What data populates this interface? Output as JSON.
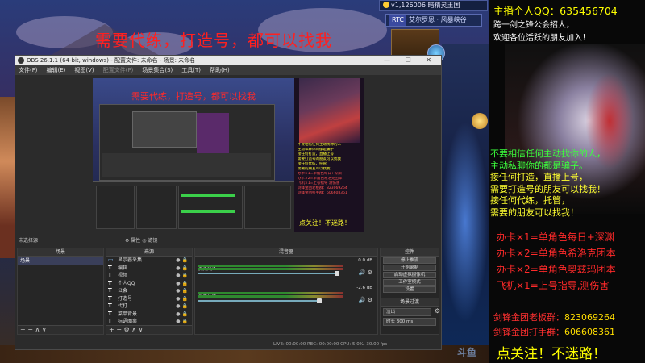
{
  "overlay": {
    "headline": "需要代练，打造号，都可以找我"
  },
  "game_hud": {
    "top_label": "v1,126006 暗精灵王国",
    "tab_chip": "RTC",
    "tab_label": "艾尔罗恩 · 风暴峡谷"
  },
  "obs": {
    "title": "OBS 26.1.1 (64-bit, windows) - 配置文件: 未命名 - 场景: 未命名",
    "window_buttons": "— ☐ ✕",
    "menu": [
      "文件(F)",
      "编辑(E)",
      "视图(V)",
      "配置文件(P)",
      "场景集合(S)",
      "工具(T)",
      "帮助(H)"
    ],
    "preview_red_text": "需要代练，打造号，都可以找我",
    "preview_right_lines": [
      "不要相信任何主动找你的人",
      "主动私聊你的都是骗子",
      "接任何打造，直播上号",
      "需要打造号的朋友可以找我",
      "接任何代练，托管",
      "需要的朋友可以找我",
      "办卡×1=单角色每日+深渊",
      "办卡×2=单角色希洛克团本",
      "飞机×1=上号指导 测伤害",
      "剑锋金团老板群：823069264",
      "剑锋金团打手群：606608361"
    ],
    "preview_footer": "点关注！不迷路！",
    "strip_left": "未选择源",
    "strip_mid": "⚙ 属性   ◎ 滤镜",
    "panels": {
      "scenes": {
        "title": "场景",
        "items": [
          "场景"
        ],
        "footer": "+ − ∧ ∨"
      },
      "sources": {
        "title": "来源",
        "items": [
          "显示器采集",
          "编辑",
          "视频",
          "个人QQ",
          "公会",
          "打造号",
          "代打",
          "菜单背景",
          "标语图案",
          "标识图标"
        ],
        "footer": "+ − ⚙ ∧ ∨"
      },
      "mixer": {
        "title": "混音器",
        "channels": [
          {
            "label": "麦克风/Aux",
            "db": "0.0 dB"
          },
          {
            "label": "桌面音频",
            "db": "-2.6 dB"
          }
        ]
      },
      "transitions": {
        "title": "场景过渡",
        "type": "淡出",
        "duration_label": "时长",
        "duration_value": "300 ms"
      },
      "controls": {
        "title": "控件",
        "buttons": [
          "停止推流",
          "开始录制",
          "启动虚拟摄像机",
          "工作室模式",
          "设置",
          "退出"
        ]
      }
    },
    "status_bar": "LIVE: 00:00:00   REC: 00:00:00   CPU: 5.0%, 30.00 fps"
  },
  "right_panel": {
    "title": "主播个人QQ：635456704",
    "sub1": "跨一剑之锋公会招人，",
    "sub2": "欢迎各位活跃的朋友加入！",
    "notices": [
      "不要相信任何主动找你的人，",
      "主动私聊你的都是骗子。",
      "接任何打造，直播上号，",
      "需要打造号的朋友可以找我！",
      "接任何代练，托管，",
      "需要的朋友可以找我！"
    ],
    "offers": [
      "办卡×1=单角色每日+深渊",
      "办卡×2=单角色希洛克团本",
      "办卡×2=单角色奥兹玛团本",
      "飞机×1=上号指导,测伤害"
    ],
    "qq_groups": [
      {
        "label": "剑锋金团老板群：",
        "number": "823069264"
      },
      {
        "label": "剑锋金团打手群：",
        "number": "606608361"
      }
    ],
    "follow": "点关注！不迷路！"
  },
  "watermark": "斗鱼"
}
